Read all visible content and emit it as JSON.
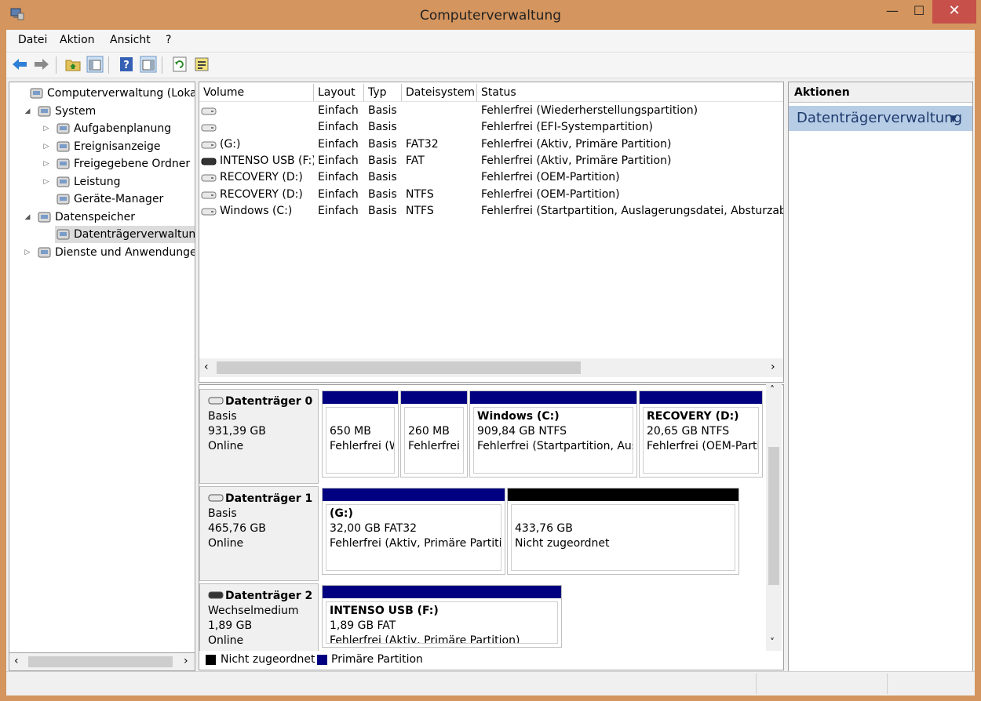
{
  "window": {
    "title": "Computerverwaltung"
  },
  "menu": [
    "Datei",
    "Aktion",
    "Ansicht",
    "?"
  ],
  "tree": {
    "items": [
      {
        "label": "Computerverwaltung (Lokal)",
        "level": 0,
        "expander": "",
        "icon": "computer-management-icon"
      },
      {
        "label": "System",
        "level": 1,
        "expander": "◢",
        "icon": "system-tools-icon"
      },
      {
        "label": "Aufgabenplanung",
        "level": 2,
        "expander": "▷",
        "icon": "clock-icon"
      },
      {
        "label": "Ereignisanzeige",
        "level": 2,
        "expander": "▷",
        "icon": "event-viewer-icon"
      },
      {
        "label": "Freigegebene Ordner",
        "level": 2,
        "expander": "▷",
        "icon": "shared-folders-icon"
      },
      {
        "label": "Leistung",
        "level": 2,
        "expander": "▷",
        "icon": "performance-icon"
      },
      {
        "label": "Geräte-Manager",
        "level": 2,
        "expander": "",
        "icon": "device-manager-icon"
      },
      {
        "label": "Datenspeicher",
        "level": 1,
        "expander": "◢",
        "icon": "storage-icon"
      },
      {
        "label": "Datenträgerverwaltung",
        "level": 2,
        "expander": "",
        "icon": "disk-management-icon",
        "selected": true
      },
      {
        "label": "Dienste und Anwendungen",
        "level": 1,
        "expander": "▷",
        "icon": "services-icon"
      }
    ]
  },
  "volumes": {
    "headers": [
      "Volume",
      "Layout",
      "Typ",
      "Dateisystem",
      "Status"
    ],
    "rows": [
      {
        "volume": "",
        "layout": "Einfach",
        "typ": "Basis",
        "fs": "",
        "status": "Fehlerfrei (Wiederherstellungspartition)",
        "icon": "drive-icon"
      },
      {
        "volume": "",
        "layout": "Einfach",
        "typ": "Basis",
        "fs": "",
        "status": "Fehlerfrei (EFI-Systempartition)",
        "icon": "drive-icon"
      },
      {
        "volume": " (G:)",
        "layout": "Einfach",
        "typ": "Basis",
        "fs": "FAT32",
        "status": "Fehlerfrei (Aktiv, Primäre Partition)",
        "icon": "drive-icon"
      },
      {
        "volume": "INTENSO USB (F:)",
        "layout": "Einfach",
        "typ": "Basis",
        "fs": "FAT",
        "status": "Fehlerfrei (Aktiv, Primäre Partition)",
        "icon": "usb-drive-icon"
      },
      {
        "volume": "RECOVERY (D:)",
        "layout": "Einfach",
        "typ": "Basis",
        "fs": "",
        "status": "Fehlerfrei (OEM-Partition)",
        "icon": "drive-icon"
      },
      {
        "volume": "RECOVERY (D:)",
        "layout": "Einfach",
        "typ": "Basis",
        "fs": "NTFS",
        "status": "Fehlerfrei (OEM-Partition)",
        "icon": "drive-icon"
      },
      {
        "volume": "Windows (C:)",
        "layout": "Einfach",
        "typ": "Basis",
        "fs": "NTFS",
        "status": "Fehlerfrei (Startpartition, Auslagerungsdatei, Absturzabbild",
        "icon": "drive-icon"
      }
    ]
  },
  "disks": [
    {
      "name": "Datenträger 0",
      "type": "Basis",
      "size": "931,39 GB",
      "state": "Online",
      "icon": "disk-icon",
      "partitions": [
        {
          "title": "",
          "line1": "650 MB",
          "line2": "Fehlerfrei (W",
          "head_color": "#000080"
        },
        {
          "title": "",
          "line1": "260 MB",
          "line2": "Fehlerfrei (",
          "head_color": "#000080"
        },
        {
          "title": "Windows  (C:)",
          "line1": "909,84 GB NTFS",
          "line2": "Fehlerfrei (Startpartition, Ausla",
          "head_color": "#000080"
        },
        {
          "title": "RECOVERY  (D:)",
          "line1": "20,65 GB NTFS",
          "line2": "Fehlerfrei (OEM-Parti",
          "head_color": "#000080"
        }
      ]
    },
    {
      "name": "Datenträger 1",
      "type": "Basis",
      "size": "465,76 GB",
      "state": "Online",
      "icon": "disk-icon",
      "partitions": [
        {
          "title": "(G:)",
          "line1": "32,00 GB FAT32",
          "line2": "Fehlerfrei (Aktiv, Primäre Partition",
          "head_color": "#000080"
        },
        {
          "title": "",
          "line1": "433,76 GB",
          "line2": "Nicht zugeordnet",
          "head_color": "#000000"
        }
      ]
    },
    {
      "name": "Datenträger 2",
      "type": "Wechselmedium",
      "size": "1,89 GB",
      "state": "Online",
      "icon": "removable-disk-icon",
      "partitions": [
        {
          "title": "INTENSO USB  (F:)",
          "line1": "1,89 GB FAT",
          "line2": "Fehlerfrei (Aktiv, Primäre Partition)",
          "head_color": "#000080"
        }
      ]
    }
  ],
  "legend": [
    {
      "label": "Nicht zugeordnet",
      "color": "#000000"
    },
    {
      "label": "Primäre Partition",
      "color": "#000080"
    }
  ],
  "actions": {
    "header": "Aktionen",
    "item": "Datenträgerverwaltung",
    "item_arrow": "▼"
  },
  "window_buttons": {
    "minimize": "—",
    "maximize": "☐",
    "close": "✕"
  }
}
